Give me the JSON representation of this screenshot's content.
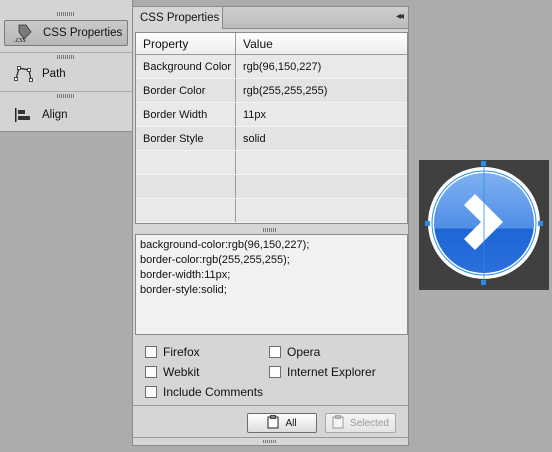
{
  "dock": {
    "items": [
      {
        "label": "CSS Properties",
        "icon": "css-icon",
        "css_glyph": ".css",
        "active": true
      },
      {
        "label": "Path",
        "icon": "path-icon",
        "active": false
      },
      {
        "label": "Align",
        "icon": "align-icon",
        "active": false
      }
    ]
  },
  "panel": {
    "tab_title": "CSS Properties",
    "collapse_glyph": "◂◂",
    "columns": {
      "property": "Property",
      "value": "Value"
    },
    "rows": [
      {
        "property": "Background Color",
        "value": "rgb(96,150,227)"
      },
      {
        "property": "Border Color",
        "value": "rgb(255,255,255)"
      },
      {
        "property": "Border Width",
        "value": "11px"
      },
      {
        "property": "Border Style",
        "value": "solid"
      }
    ],
    "code_lines": [
      "background-color:rgb(96,150,227);",
      "border-color:rgb(255,255,255);",
      "border-width:11px;",
      "border-style:solid;"
    ],
    "options": {
      "firefox": "Firefox",
      "opera": "Opera",
      "webkit": "Webkit",
      "internet_explorer": "Internet Explorer",
      "include_comments": "Include Comments"
    },
    "buttons": {
      "all": "All",
      "selected": "Selected"
    }
  },
  "artwork": {
    "icon": "chevron-right-icon",
    "fill_color": "#6096e3",
    "border_color": "#ffffff",
    "background_color": "#404040",
    "selection_color": "#2a8ee8"
  }
}
